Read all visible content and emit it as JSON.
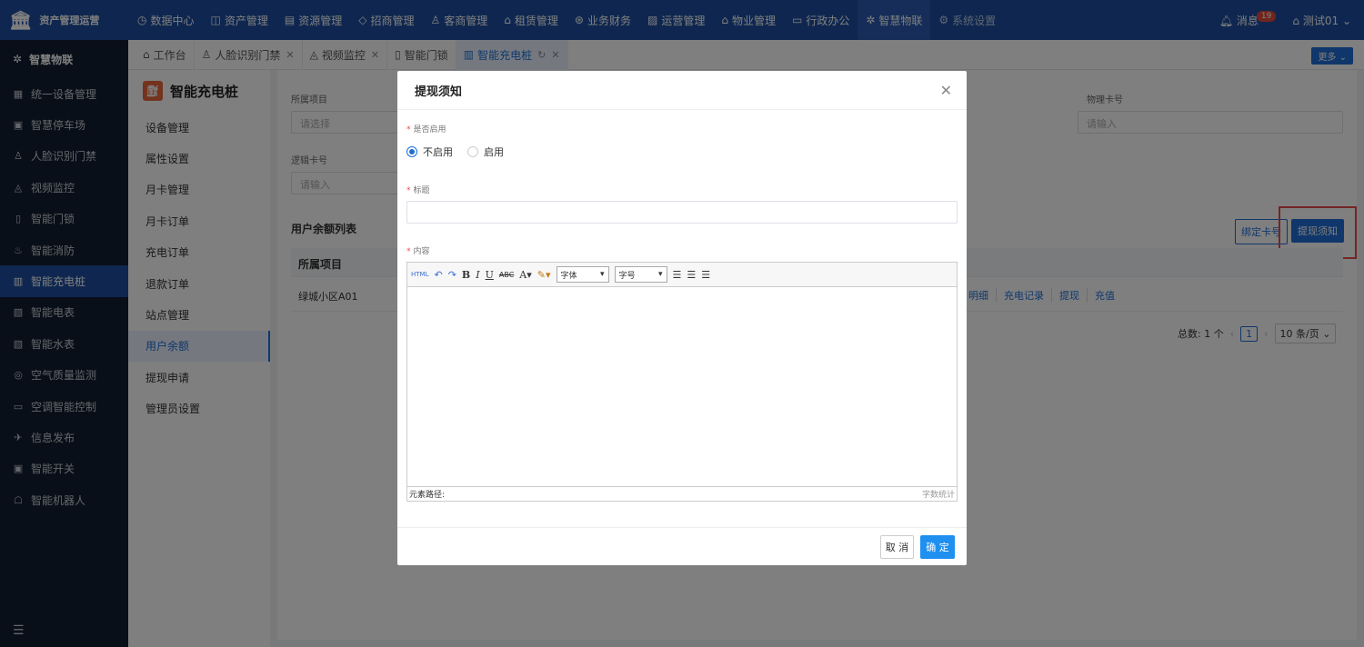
{
  "app": {
    "logo_text": "资产管理运营"
  },
  "nav": {
    "items": [
      {
        "label": "数据中心",
        "icon": "◷"
      },
      {
        "label": "资产管理",
        "icon": "◫"
      },
      {
        "label": "资源管理",
        "icon": "▤"
      },
      {
        "label": "招商管理",
        "icon": "◇"
      },
      {
        "label": "客商管理",
        "icon": "♙"
      },
      {
        "label": "租赁管理",
        "icon": "⌂"
      },
      {
        "label": "业务财务",
        "icon": "⊛"
      },
      {
        "label": "运营管理",
        "icon": "▨"
      },
      {
        "label": "物业管理",
        "icon": "⌂"
      },
      {
        "label": "行政办公",
        "icon": "▭"
      },
      {
        "label": "智慧物联",
        "icon": "✲"
      },
      {
        "label": "系统设置",
        "icon": "⚙"
      }
    ],
    "active": "智慧物联",
    "messages_label": "消息",
    "messages_count": "19",
    "user_label": "测试01"
  },
  "sidebar": {
    "header": "智慧物联",
    "items": [
      {
        "label": "统一设备管理",
        "icon": "▦"
      },
      {
        "label": "智慧停车场",
        "icon": "▣"
      },
      {
        "label": "人脸识别门禁",
        "icon": "♙"
      },
      {
        "label": "视频监控",
        "icon": "◬"
      },
      {
        "label": "智能门锁",
        "icon": "▯"
      },
      {
        "label": "智能消防",
        "icon": "♨"
      },
      {
        "label": "智能充电桩",
        "icon": "▥"
      },
      {
        "label": "智能电表",
        "icon": "▧"
      },
      {
        "label": "智能水表",
        "icon": "▧"
      },
      {
        "label": "空气质量监测",
        "icon": "◎"
      },
      {
        "label": "空调智能控制",
        "icon": "▭"
      },
      {
        "label": "信息发布",
        "icon": "✈"
      },
      {
        "label": "智能开关",
        "icon": "▣"
      },
      {
        "label": "智能机器人",
        "icon": "☖"
      }
    ],
    "active": "智能充电桩"
  },
  "tabs": {
    "items": [
      {
        "label": "工作台",
        "icon": "⌂",
        "closable": false
      },
      {
        "label": "人脸识别门禁",
        "icon": "♙",
        "closable": true
      },
      {
        "label": "视频监控",
        "icon": "◬",
        "closable": true
      },
      {
        "label": "智能门锁",
        "icon": "▯",
        "closable": false
      },
      {
        "label": "智能充电桩",
        "icon": "▥",
        "closable": true
      }
    ],
    "active": "智能充电桩",
    "more_label": "更多"
  },
  "left_panel": {
    "title": "智能充电桩",
    "items": [
      "设备管理",
      "属性设置",
      "月卡管理",
      "月卡订单",
      "充电订单",
      "退款订单",
      "站点管理",
      "用户余额",
      "提现申请",
      "管理员设置"
    ],
    "active": "用户余额"
  },
  "filters": {
    "project_label": "所属项目",
    "project_placeholder": "请选择",
    "logic_card_label": "逻辑卡号",
    "logic_card_placeholder": "请输入",
    "physical_card_label": "物理卡号",
    "physical_card_placeholder": "请输入"
  },
  "list": {
    "title": "用户余额列表",
    "bind_card_button": "绑定卡号",
    "withdraw_notice_button": "提现须知",
    "columns": [
      "所属项目"
    ],
    "rows": [
      {
        "project": "绿城小区A01"
      }
    ],
    "row_actions": [
      "明细",
      "充电记录",
      "提现",
      "充值"
    ]
  },
  "pagination": {
    "total_label": "总数: 1 个",
    "current_page": "1",
    "page_size": "10 条/页"
  },
  "modal": {
    "title": "提现须知",
    "enable_label": "是否启用",
    "option_disabled": "不启用",
    "option_enabled": "启用",
    "selected_option": "不启用",
    "title_field_label": "标题",
    "title_field_value": "",
    "content_label": "内容",
    "editor": {
      "font_family_select": "字体",
      "font_size_select": "字号",
      "element_path_label": "元素路径:",
      "word_count_label": "字数统计"
    },
    "cancel_button": "取 消",
    "ok_button": "确 定"
  },
  "colors": {
    "primary": "#1f6fd6",
    "topbar": "#1e4fa0",
    "sidebar": "#121e30",
    "highlight": "#e84b4b"
  }
}
